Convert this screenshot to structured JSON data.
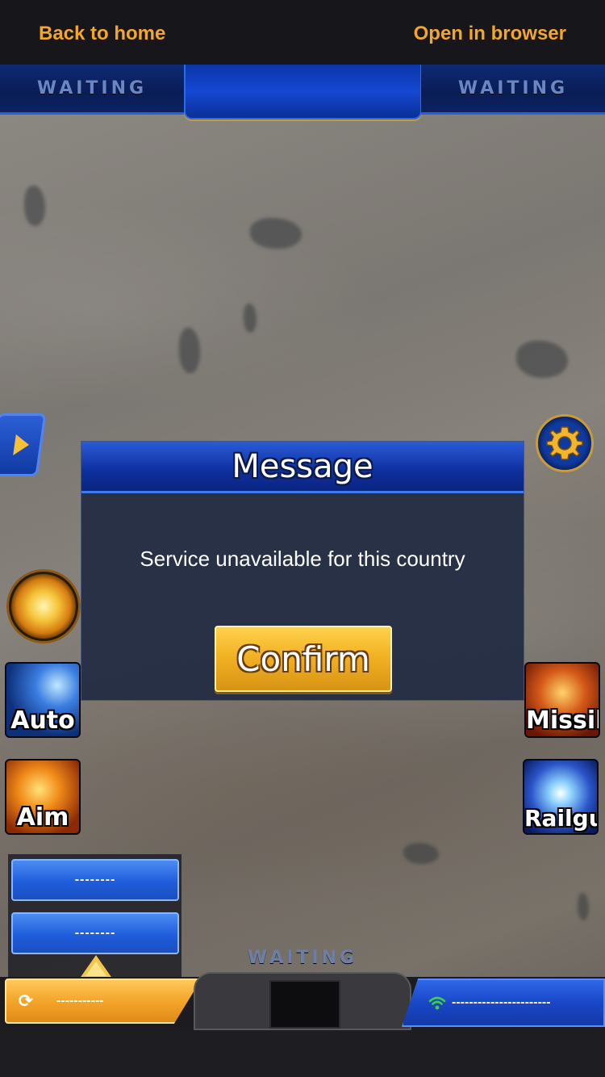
{
  "topbar": {
    "back_label": "Back to home",
    "open_label": "Open in browser",
    "link_color": "#f3a72a"
  },
  "hud": {
    "left_status": "WAITING",
    "right_status": "WAITING",
    "bottom_status": "WAITING"
  },
  "icons": {
    "side_tab": "play-arrow-icon",
    "settings": "gear-icon",
    "orb": "energy-orb-icon",
    "refresh": "refresh-icon",
    "wifi": "wifi-icon"
  },
  "skills": {
    "auto": "Auto",
    "aim": "Aim",
    "missile": "Missile",
    "railgun": "Railgun"
  },
  "modal": {
    "title": "Message",
    "message": "Service unavailable for this country",
    "confirm_label": "Confirm"
  },
  "panel": {
    "button1_label": "--------",
    "button2_label": "--------"
  },
  "bottom_bar": {
    "left_label": "-----------",
    "right_label": "-----------------------"
  },
  "colors": {
    "accent_orange": "#f3a72a",
    "hud_blue": "#1548d2",
    "modal_bg": "#212b42",
    "signal_green": "#3fd13f"
  }
}
